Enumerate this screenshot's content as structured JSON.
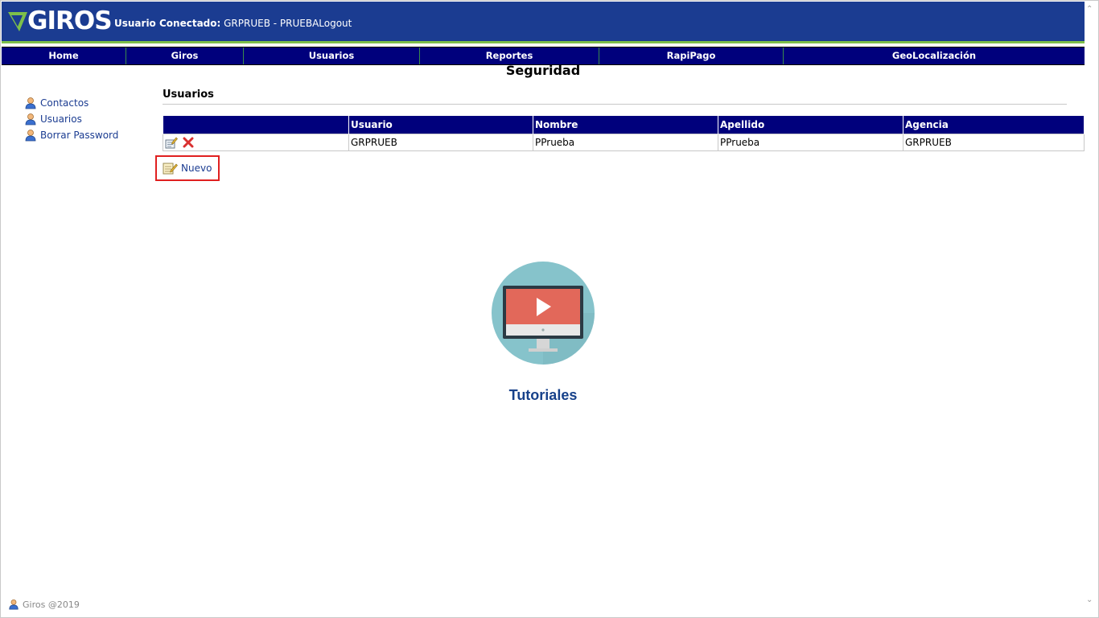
{
  "header": {
    "logo_text": "GIROS",
    "user_label": "Usuario Conectado:",
    "user_value": "GRPRUEB - PRUEBA",
    "logout": "Logout"
  },
  "nav": [
    {
      "label": "Home"
    },
    {
      "label": "Giros"
    },
    {
      "label": "Usuarios"
    },
    {
      "label": "Reportes"
    },
    {
      "label": "RapiPago"
    },
    {
      "label": "GeoLocalización"
    }
  ],
  "page_title": "Seguridad",
  "sidebar": {
    "items": [
      {
        "label": "Contactos",
        "icon": "user-icon"
      },
      {
        "label": "Usuarios",
        "icon": "user-icon"
      },
      {
        "label": "Borrar Password",
        "icon": "user-icon"
      }
    ]
  },
  "section_title": "Usuarios",
  "table": {
    "columns": [
      "",
      "Usuario",
      "Nombre",
      "Apellido",
      "Agencia"
    ],
    "rows": [
      {
        "usuario": "GRPRUEB",
        "nombre": "PPrueba",
        "apellido": "PPrueba",
        "agencia": "GRPRUEB"
      }
    ]
  },
  "nuevo_label": "Nuevo",
  "tutorial_label": "Tutoriales",
  "footer_text": "Giros @2019",
  "colors": {
    "header_bg": "#1b3c91",
    "nav_bg": "#00007c",
    "accent_green": "#7dbf4a",
    "link": "#1b3c91",
    "highlight_border": "#e02020"
  }
}
